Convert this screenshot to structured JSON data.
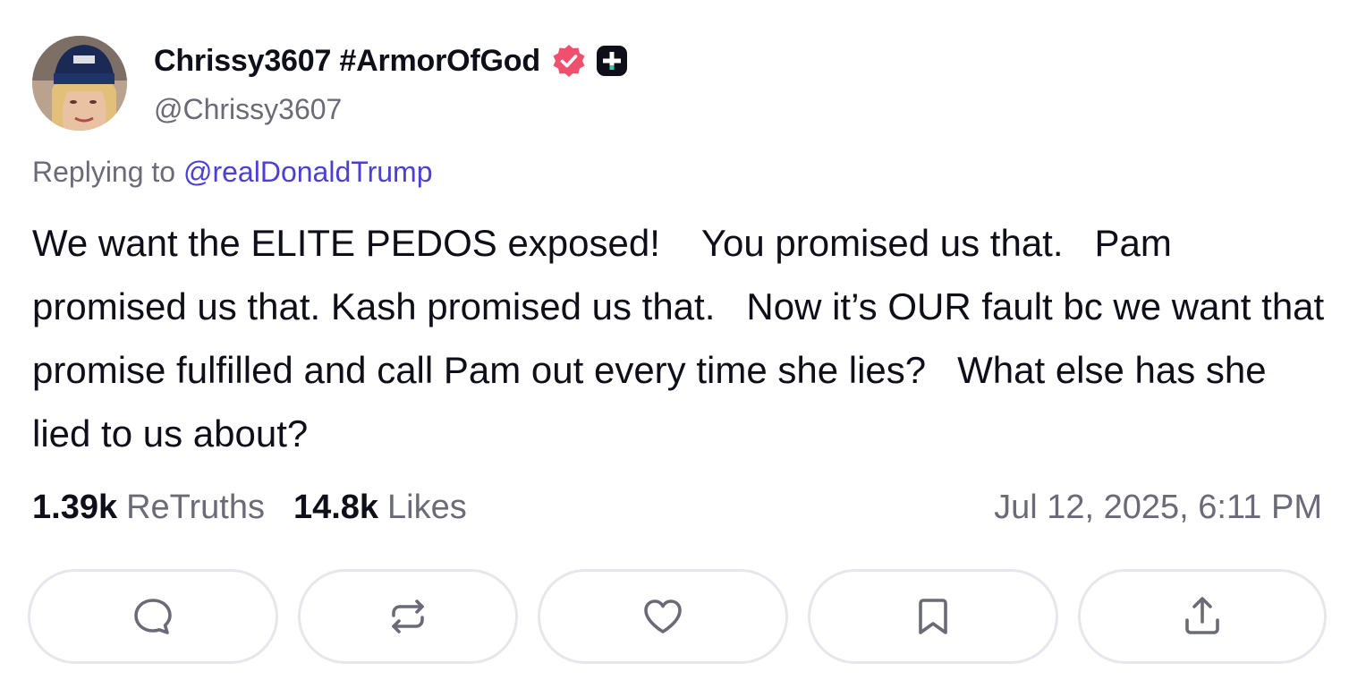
{
  "author": {
    "display_name": "Chrissy3607 #ArmorOfGod",
    "handle": "@Chrissy3607",
    "verified_color": "#f0506e"
  },
  "reply": {
    "prefix": "Replying to",
    "target": "@realDonaldTrump"
  },
  "post": {
    "text": "We want the ELITE PEDOS exposed!    You promised us that.   Pam promised us that. Kash promised us that.   Now it’s OUR fault bc we want that promise fulfilled and call Pam out every time she lies?   What else has she lied to us about?"
  },
  "stats": {
    "retruths_count": "1.39k",
    "retruths_label": "ReTruths",
    "likes_count": "14.8k",
    "likes_label": "Likes"
  },
  "timestamp": "Jul 12, 2025, 6:11 PM",
  "actions": [
    {
      "icon": "comment-icon"
    },
    {
      "icon": "retruth-icon"
    },
    {
      "icon": "heart-icon"
    },
    {
      "icon": "bookmark-icon"
    },
    {
      "icon": "share-icon"
    }
  ],
  "colors": {
    "text": "#0f0f1a",
    "muted": "#6b6b78",
    "link": "#4b3fd6",
    "border": "#e6e6ec"
  }
}
